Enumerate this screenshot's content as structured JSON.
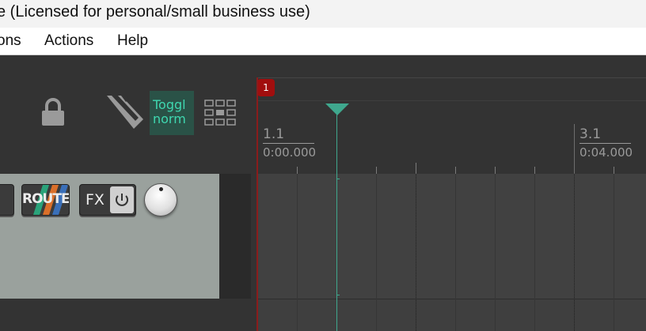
{
  "window": {
    "title": "e (Licensed for personal/small business use)"
  },
  "menu": {
    "items": [
      {
        "label": "ons"
      },
      {
        "label": "Actions"
      },
      {
        "label": "Help"
      }
    ]
  },
  "toolbar": {
    "toggle_label_line1": "Toggl",
    "toggle_label_line2": "norm",
    "icons": [
      "lock-icon",
      "ripple-edit-icon",
      "grid-snap-icon"
    ]
  },
  "ruler": {
    "marker_number": "1",
    "ticks": [
      {
        "bar": "1.1",
        "time": "0:00.000"
      },
      {
        "bar": "3.1",
        "time": "0:04.000"
      }
    ]
  },
  "track": {
    "route_label": "ROUTE",
    "fx_label": "FX"
  },
  "colors": {
    "accent": "#3fa88e",
    "marker": "#a10e0e",
    "toggle_bg": "#2a5247",
    "toggle_text": "#3fd7b0"
  }
}
